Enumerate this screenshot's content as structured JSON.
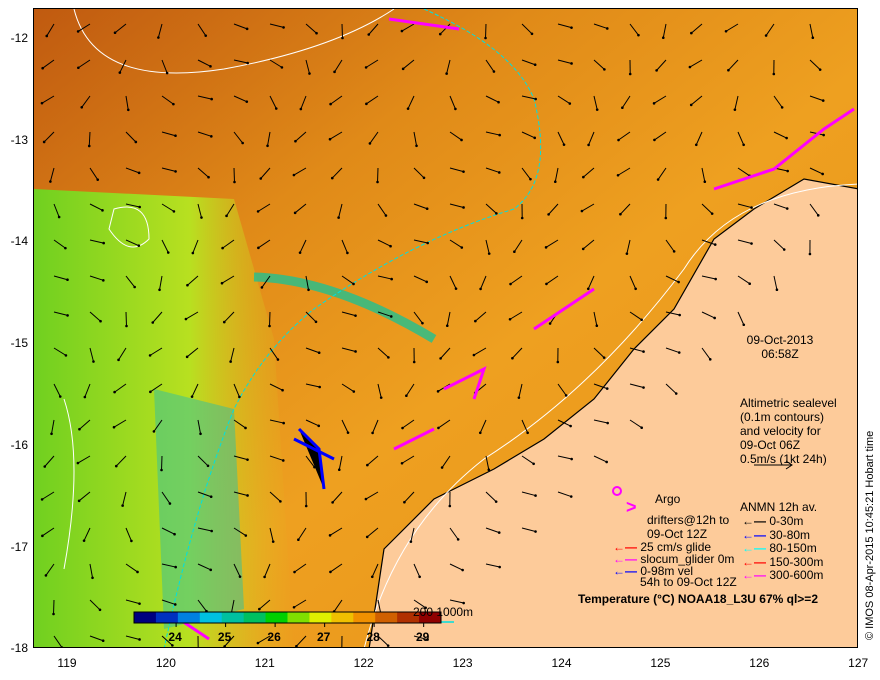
{
  "map": {
    "lat_labels": [
      "-12",
      "-13",
      "-14",
      "-15",
      "-16",
      "-17",
      "-18"
    ],
    "lon_labels": [
      "119",
      "120",
      "121",
      "122",
      "123",
      "124",
      "125",
      "126",
      "127"
    ],
    "date": "09-Oct-2013",
    "time": "06:58Z",
    "altimetry_note": [
      "Altimetric sealevel",
      "(0.1m contours)",
      "and velocity for",
      "09-Oct 06Z",
      "0.5m/s (1kt 24h)"
    ],
    "credit": "© IMOS 08-Apr-2015 10:45:21 Hobart time"
  },
  "legend": {
    "argo": "Argo",
    "drifters": [
      "drifters@12h to",
      "09-Oct 12Z"
    ],
    "glider_items": [
      {
        "label": "25 cm/s glide",
        "color": "#ff0000"
      },
      {
        "label": "slocum_glider 0m",
        "color": "#ff00ff"
      },
      {
        "label": "0-98m vel",
        "color": "#0000ff"
      }
    ],
    "glider_note": "54h to 09-Oct 12Z",
    "anmn_title": "ANMN 12h av.",
    "anmn_items": [
      {
        "label": "0-30m",
        "color": "#000000"
      },
      {
        "label": "30-80m",
        "color": "#0000ff"
      },
      {
        "label": "80-150m",
        "color": "#00ffff"
      },
      {
        "label": "150-300m",
        "color": "#ff0000"
      },
      {
        "label": "300-600m",
        "color": "#ff00ff"
      }
    ],
    "scale_label": "200  1000m"
  },
  "colorbar": {
    "title": "Temperature (°C) NOAA18_L3U 67% ql>=2",
    "ticks": [
      "24",
      "25",
      "26",
      "27",
      "28",
      "29"
    ],
    "range": [
      23.15,
      29.35
    ]
  },
  "colors": {
    "land": "#fdcb9a",
    "argo": "#ff00ff",
    "drifter": "#ff00ff",
    "contour": "#ffffff",
    "isobath": "#00e0e0"
  }
}
